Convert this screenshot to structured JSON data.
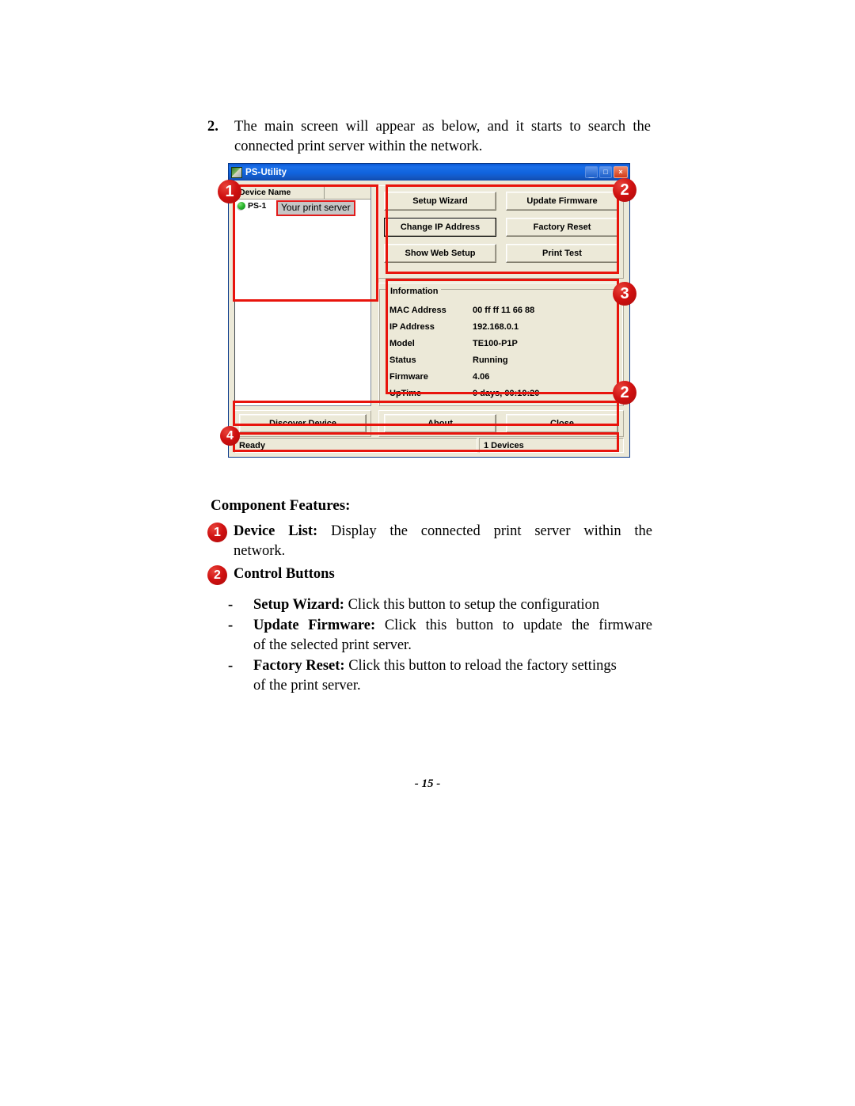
{
  "step": {
    "number": "2.",
    "line1": "The main screen will appear as below, and it starts to search the",
    "line2": "connected print server within the network."
  },
  "app": {
    "title": "PS-Utility",
    "title_icon": "app-icon",
    "window_buttons": {
      "minimize": "_",
      "maximize": "□",
      "close": "×"
    },
    "device_list": {
      "columns": [
        "Device Name",
        ""
      ],
      "rows": [
        {
          "status_icon": "green-globe-icon",
          "name": "PS-1"
        }
      ],
      "callout": "Your print server"
    },
    "control_buttons": [
      {
        "label": "Setup Wizard",
        "focused": false
      },
      {
        "label": "Update Firmware",
        "focused": false
      },
      {
        "label": "Change IP Address",
        "focused": true
      },
      {
        "label": "Factory Reset",
        "focused": false
      },
      {
        "label": "Show Web Setup",
        "focused": false
      },
      {
        "label": "Print Test",
        "focused": false
      }
    ],
    "information": {
      "legend": "Information",
      "rows": [
        {
          "key": "MAC Address",
          "value": "00 ff ff 11 66 88"
        },
        {
          "key": "IP Address",
          "value": "192.168.0.1"
        },
        {
          "key": "Model",
          "value": "TE100-P1P"
        },
        {
          "key": "Status",
          "value": "Running"
        },
        {
          "key": "Firmware",
          "value": "4.06"
        },
        {
          "key": "UpTime",
          "value": "0 days, 00:10:20"
        }
      ]
    },
    "bottom_buttons": [
      {
        "label": "Discover Device"
      },
      {
        "label": "About"
      },
      {
        "label": "Close"
      }
    ],
    "status_bar": {
      "left": "Ready",
      "right": "1 Devices"
    }
  },
  "markers": {
    "m1": "1",
    "m2_top": "2",
    "m3": "3",
    "m2_bottom": "2",
    "m4": "4"
  },
  "features": {
    "title": "Component Features:",
    "items": [
      {
        "marker": "1",
        "label": "Device List:",
        "line1": "Display  the  connected  print  server  within  the",
        "line2": "network."
      },
      {
        "marker": "2",
        "label": "Control Buttons",
        "line1": "",
        "line2": ""
      }
    ]
  },
  "bullets": [
    {
      "dash": "-",
      "label": "Setup Wizard:",
      "line1": "Click this button to setup the configuration",
      "line2": ""
    },
    {
      "dash": "-",
      "label": "Update Firmware:",
      "line1": "Click  this  button  to  update  the  firmware",
      "line2": "of the selected print server."
    },
    {
      "dash": "-",
      "label": "Factory Reset:",
      "line1": "Click this button to reload the factory settings",
      "line2": "of the print server."
    }
  ],
  "page_number": "- 15 -"
}
